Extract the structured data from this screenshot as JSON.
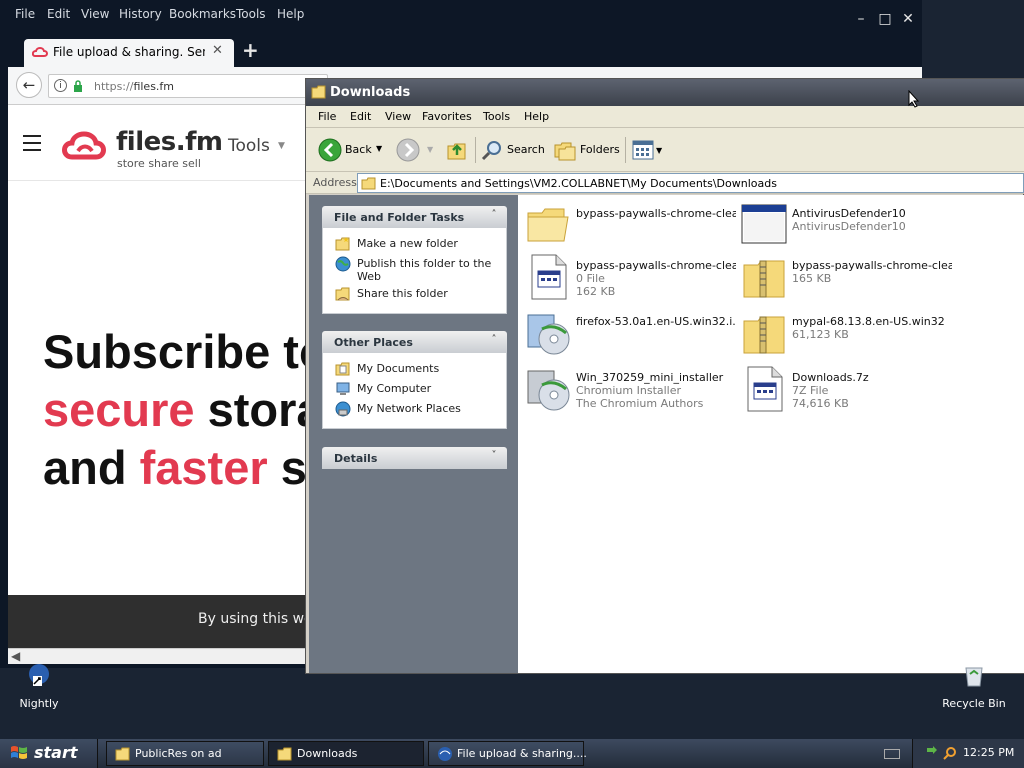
{
  "firefox": {
    "menu": [
      "File",
      "Edit",
      "View",
      "History",
      "Bookmarks",
      "Tools",
      "Help"
    ],
    "tab_title": "File upload & sharing. Send la...",
    "new_tab_label": "+",
    "url_protocol": "https://",
    "url_domain": "files.fm",
    "page": {
      "brand": "files.fm",
      "tagline": "store share sell",
      "tools_label": "Tools",
      "headline_line1": "Subscribe to",
      "headline_line2_red": "secure",
      "headline_line2_rest": " stora",
      "headline_line3_plain": "and ",
      "headline_line3_red": "faster",
      "headline_line3_rest": " s",
      "cookie_text": "By using this we"
    },
    "accent_color": "#e23a50"
  },
  "explorer": {
    "title": "Downloads",
    "menu": [
      "File",
      "Edit",
      "View",
      "Favorites",
      "Tools",
      "Help"
    ],
    "toolbar": {
      "back": "Back",
      "search": "Search",
      "folders": "Folders"
    },
    "address_label": "Address",
    "address_value": "E:\\Documents and Settings\\VM2.COLLABNET\\My Documents\\Downloads",
    "panels": {
      "file_folder_tasks": {
        "title": "File and Folder Tasks",
        "items": [
          "Make a new folder",
          "Publish this folder to the",
          "Web",
          "Share this folder"
        ]
      },
      "other_places": {
        "title": "Other Places",
        "items": [
          "My Documents",
          "My Computer",
          "My Network Places"
        ]
      },
      "details": {
        "title": "Details"
      }
    },
    "files": [
      {
        "name": "bypass-paywalls-chrome-clea...",
        "line1": "",
        "line2": "",
        "icon": "folder-icon"
      },
      {
        "name": "AntivirusDefender10",
        "line1": "AntivirusDefender10",
        "line2": "",
        "icon": "application-window-icon"
      },
      {
        "name": "bypass-paywalls-chrome-clea...",
        "line1": "0 File",
        "line2": "162 KB",
        "icon": "generic-file-icon"
      },
      {
        "name": "bypass-paywalls-chrome-clea...",
        "line1": "165 KB",
        "line2": "",
        "icon": "zip-folder-icon"
      },
      {
        "name": "firefox-53.0a1.en-US.win32.i...",
        "line1": "",
        "line2": "",
        "icon": "installer-disc-icon"
      },
      {
        "name": "mypal-68.13.8.en-US.win32",
        "line1": "61,123 KB",
        "line2": "",
        "icon": "zip-folder-icon"
      },
      {
        "name": "Win_370259_mini_installer",
        "line1": "Chromium Installer",
        "line2": "The Chromium Authors",
        "icon": "installer-disc-icon"
      },
      {
        "name": "Downloads.7z",
        "line1": "7Z File",
        "line2": "74,616 KB",
        "icon": "generic-file-icon"
      }
    ]
  },
  "desktop": {
    "icons": [
      "Nightly",
      "Recycle Bin"
    ]
  },
  "taskbar": {
    "start_label": "start",
    "buttons": [
      "PublicRes on ad",
      "Downloads",
      "File upload & sharing...."
    ],
    "clock": "12:25 PM"
  }
}
